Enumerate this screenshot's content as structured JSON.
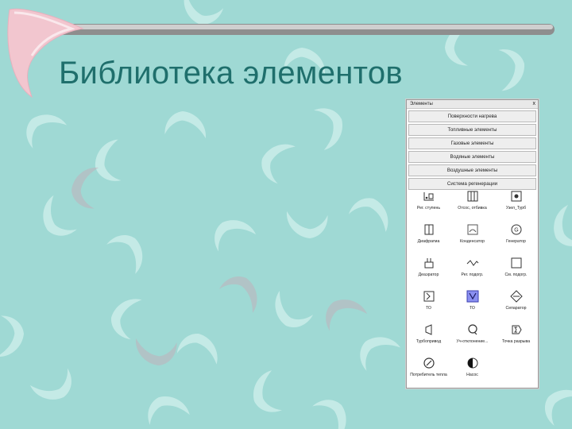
{
  "title": "Библиотека элементов",
  "panel": {
    "header": "Элементы",
    "close": "x",
    "categories": [
      {
        "label": "Поверхности нагрева"
      },
      {
        "label": "Топливные элементы"
      },
      {
        "label": "Газовые элементы"
      },
      {
        "label": "Водяные элементы"
      },
      {
        "label": "Воздушные элементы"
      },
      {
        "label": "Система регенерации"
      }
    ],
    "elements": [
      {
        "label": "Рег. ступень",
        "icon": "regulating-stage-icon"
      },
      {
        "label": "Отсос, отбивка",
        "icon": "extraction-icon"
      },
      {
        "label": "Узел_Турб",
        "icon": "turbine-node-icon"
      },
      {
        "label": "Диафрагма",
        "icon": "diaphragm-icon"
      },
      {
        "label": "Конденсатор",
        "icon": "condenser-icon"
      },
      {
        "label": "Генератор",
        "icon": "generator-icon"
      },
      {
        "label": "Деаэратор",
        "icon": "deaerator-icon"
      },
      {
        "label": "Рег. подогр.",
        "icon": "reg-heater-icon"
      },
      {
        "label": "См. подогр.",
        "icon": "mixing-heater-icon"
      },
      {
        "label": "ТО",
        "icon": "heat-exchanger-icon"
      },
      {
        "label": "ТО",
        "icon": "heat-exchanger-selected-icon"
      },
      {
        "label": "Сепаратор",
        "icon": "separator-icon"
      },
      {
        "label": "Турбопривод",
        "icon": "turbo-drive-icon"
      },
      {
        "label": "Уч-отклонение...",
        "icon": "deviation-icon"
      },
      {
        "label": "Точка разрыва",
        "icon": "break-point-icon"
      },
      {
        "label": "Потребитель тепла",
        "icon": "heat-consumer-icon"
      },
      {
        "label": "Насос",
        "icon": "pump-icon"
      }
    ]
  }
}
